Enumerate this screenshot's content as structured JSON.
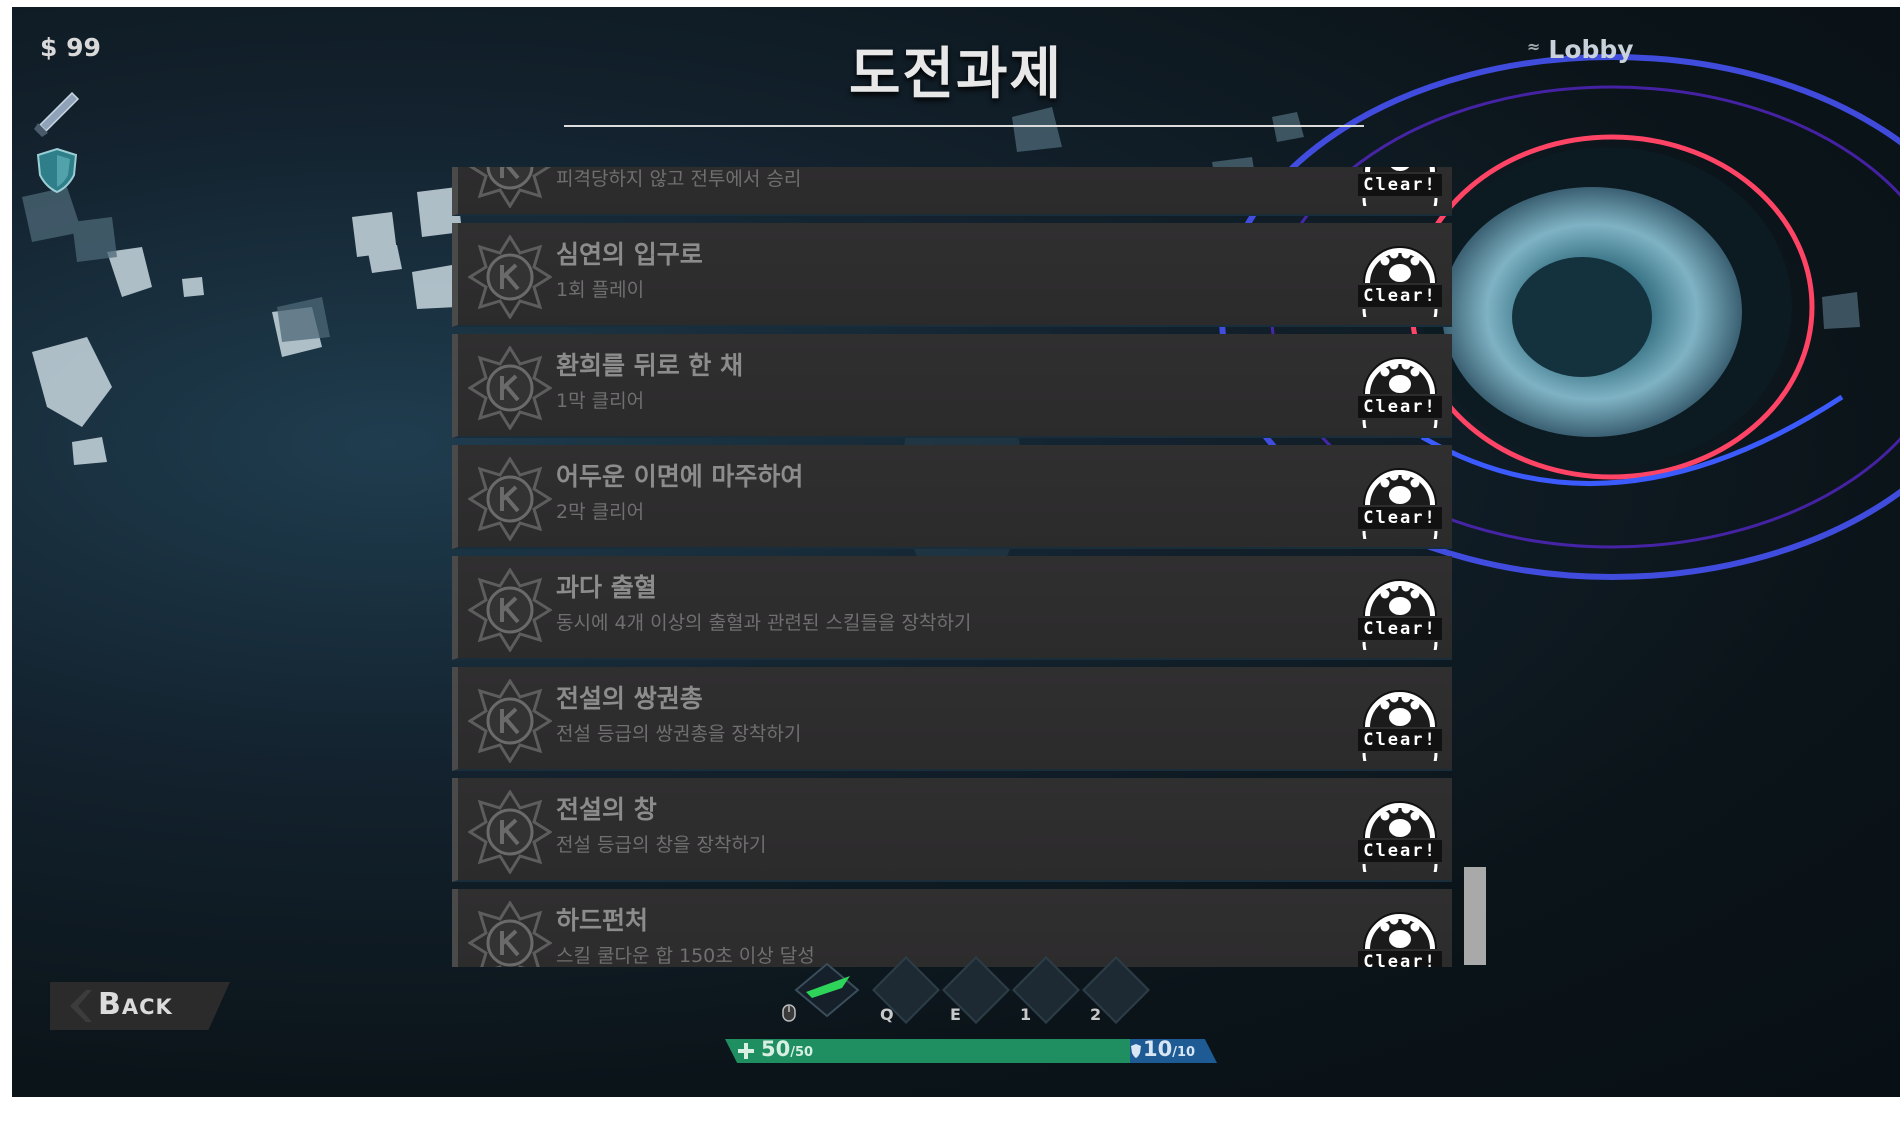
{
  "hud": {
    "money": "$ 99",
    "lobby_label": "Lobby"
  },
  "header": {
    "title": "도전과제"
  },
  "achievements": [
    {
      "name": "",
      "desc": "피격당하지 않고 전투에서 승리",
      "status": "Clear!"
    },
    {
      "name": "심연의 입구로",
      "desc": "1회 플레이",
      "status": "Clear!"
    },
    {
      "name": "환희를 뒤로 한 채",
      "desc": "1막 클리어",
      "status": "Clear!"
    },
    {
      "name": "어두운 이면에 마주하여",
      "desc": "2막 클리어",
      "status": "Clear!"
    },
    {
      "name": "과다 출혈",
      "desc": "동시에 4개 이상의 출혈과 관련된 스킬들을 장착하기",
      "status": "Clear!"
    },
    {
      "name": "전설의 쌍권총",
      "desc": "전설 등급의 쌍권총을 장착하기",
      "status": "Clear!"
    },
    {
      "name": "전설의 창",
      "desc": "전설 등급의 창을 장착하기",
      "status": "Clear!"
    },
    {
      "name": "하드펀처",
      "desc": "스킬 쿨다운 합 150초 이상 달성",
      "status": "Clear!"
    }
  ],
  "footer": {
    "back_label": "Back",
    "skill_keys": [
      "Q",
      "E",
      "1",
      "2"
    ],
    "hp_current": "50",
    "hp_max": "/50",
    "shield_current": "10",
    "shield_max": "/10"
  },
  "colors": {
    "hp": "#1f8f61",
    "shield": "#1e5a93",
    "row_bg": "#2e2d2e"
  },
  "icons": [
    "sword-icon",
    "shield-icon",
    "achievement-k-badge-icon",
    "paw-clear-stamp-icon",
    "mouse-icon",
    "back-chevron-icon"
  ]
}
